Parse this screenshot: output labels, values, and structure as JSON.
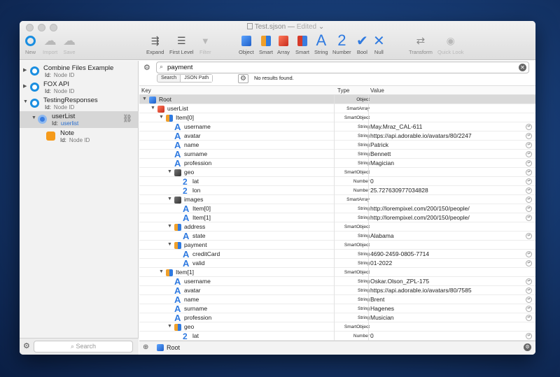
{
  "window": {
    "title": "Test.sjson",
    "state": "Edited"
  },
  "toolbar": {
    "new": "New",
    "import": "Import",
    "save": "Save",
    "expand": "Expand",
    "first_level": "First Level",
    "filter": "Filter",
    "object": "Object",
    "smart": "Smart",
    "array": "Array",
    "smart2": "Smart",
    "string": "String",
    "number": "Number",
    "bool": "Bool",
    "null": "Null",
    "transform": "Transform",
    "quick_look": "Quick Look"
  },
  "sidebar": {
    "items": [
      {
        "name": "Combine Files Example",
        "id_label": "Id:",
        "id": "Node ID"
      },
      {
        "name": "FOX API",
        "id_label": "Id:",
        "id": "Node ID"
      },
      {
        "name": "TestingResponses",
        "id_label": "Id:",
        "id": "Node ID"
      },
      {
        "name": "userList",
        "id_label": "Id:",
        "id": "userlist"
      },
      {
        "name": "Note",
        "id_label": "Id:",
        "id": "Node ID"
      }
    ],
    "search_placeholder": "Search"
  },
  "search": {
    "query": "payment",
    "mode_search": "Search",
    "mode_json": "JSON Path",
    "result": "No results found."
  },
  "columns": {
    "key": "Key",
    "type": "Type",
    "value": "Value"
  },
  "rows": [
    {
      "key": "Root",
      "type": "Object",
      "value": "",
      "depth": 0,
      "icon": "obj"
    },
    {
      "key": "userList",
      "type": "SmartArray",
      "value": "",
      "depth": 1,
      "icon": "arr"
    },
    {
      "key": "Item[0]",
      "type": "SmartObject",
      "value": "",
      "depth": 2,
      "icon": "sobj"
    },
    {
      "key": "username",
      "type": "String",
      "value": "May.Mraz_CAL-611",
      "depth": 3,
      "icon": "A"
    },
    {
      "key": "avatar",
      "type": "String",
      "value": "https://api.adorable.io/avatars/80/2247",
      "depth": 3,
      "icon": "A"
    },
    {
      "key": "name",
      "type": "String",
      "value": "Patrick",
      "depth": 3,
      "icon": "A"
    },
    {
      "key": "surname",
      "type": "String",
      "value": "Bennett",
      "depth": 3,
      "icon": "A"
    },
    {
      "key": "profession",
      "type": "String",
      "value": "Magician",
      "depth": 3,
      "icon": "A"
    },
    {
      "key": "geo",
      "type": "SmartObject",
      "value": "",
      "depth": 3,
      "icon": "sarr"
    },
    {
      "key": "lat",
      "type": "Number",
      "value": "0",
      "depth": 4,
      "icon": "N"
    },
    {
      "key": "lon",
      "type": "Number",
      "value": "25.727630977034828",
      "depth": 4,
      "icon": "N"
    },
    {
      "key": "images",
      "type": "SmartArray",
      "value": "",
      "depth": 3,
      "icon": "sarr"
    },
    {
      "key": "Item[0]",
      "type": "String",
      "value": "http://lorempixel.com/200/150/people/",
      "depth": 4,
      "icon": "A"
    },
    {
      "key": "Item[1]",
      "type": "String",
      "value": "http://lorempixel.com/200/150/people/",
      "depth": 4,
      "icon": "A"
    },
    {
      "key": "address",
      "type": "SmartObject",
      "value": "",
      "depth": 3,
      "icon": "sobj"
    },
    {
      "key": "state",
      "type": "String",
      "value": "Alabama",
      "depth": 4,
      "icon": "A"
    },
    {
      "key": "payment",
      "type": "SmartObject",
      "value": "",
      "depth": 3,
      "icon": "sobj"
    },
    {
      "key": "creditCard",
      "type": "String",
      "value": "4690-2459-0805-7714",
      "depth": 4,
      "icon": "A"
    },
    {
      "key": "valid",
      "type": "String",
      "value": "01-2022",
      "depth": 4,
      "icon": "A"
    },
    {
      "key": "Item[1]",
      "type": "SmartObject",
      "value": "",
      "depth": 2,
      "icon": "sobj"
    },
    {
      "key": "username",
      "type": "String",
      "value": "Oskar.Olson_ZPL-175",
      "depth": 3,
      "icon": "A"
    },
    {
      "key": "avatar",
      "type": "String",
      "value": "https://api.adorable.io/avatars/80/7585",
      "depth": 3,
      "icon": "A"
    },
    {
      "key": "name",
      "type": "String",
      "value": "Brent",
      "depth": 3,
      "icon": "A"
    },
    {
      "key": "surname",
      "type": "String",
      "value": "Hagenes",
      "depth": 3,
      "icon": "A"
    },
    {
      "key": "profession",
      "type": "String",
      "value": "Musician",
      "depth": 3,
      "icon": "A"
    },
    {
      "key": "geo",
      "type": "SmartObject",
      "value": "",
      "depth": 3,
      "icon": "sobj"
    },
    {
      "key": "lat",
      "type": "Number",
      "value": "0",
      "depth": 4,
      "icon": "N"
    }
  ],
  "path_bar": {
    "root": "Root"
  }
}
